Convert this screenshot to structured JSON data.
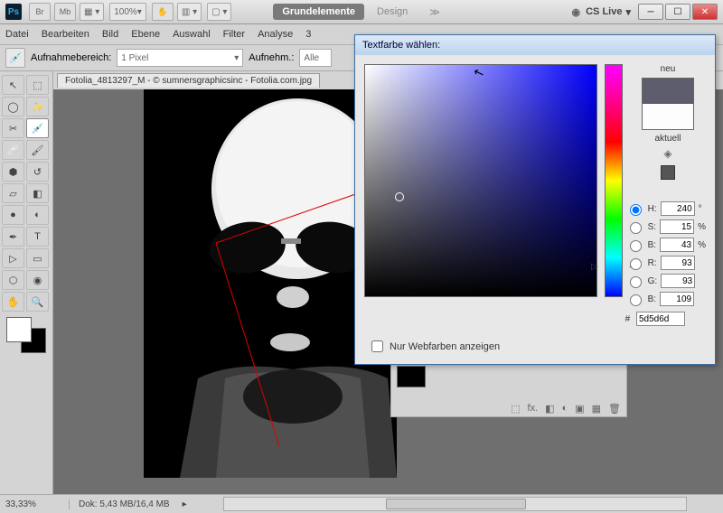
{
  "titlebar": {
    "zoom": "100%",
    "tabs": {
      "grundelemente": "Grundelemente",
      "design": "Design"
    },
    "cslive": "CS Live"
  },
  "menu": [
    "Datei",
    "Bearbeiten",
    "Bild",
    "Ebene",
    "Auswahl",
    "Filter",
    "Analyse",
    "3"
  ],
  "options": {
    "label1": "Aufnahmebereich:",
    "val1": "1 Pixel",
    "label2": "Aufnehm.:",
    "val2": "Alle"
  },
  "doc": {
    "tab": "Fotolia_4813297_M - © sumnersgraphicsinc - Fotolia.com.jpg"
  },
  "status": {
    "zoom": "33,33%",
    "dok": "Dok: 5,43 MB/16,4 MB"
  },
  "picker": {
    "title": "Textfarbe wählen:",
    "webonly": "Nur Webfarben anzeigen",
    "neu": "neu",
    "aktuell": "aktuell",
    "H": "240",
    "S": "15",
    "B": "43",
    "R": "93",
    "G": "93",
    "B2": "109",
    "hex": "5d5d6d"
  }
}
